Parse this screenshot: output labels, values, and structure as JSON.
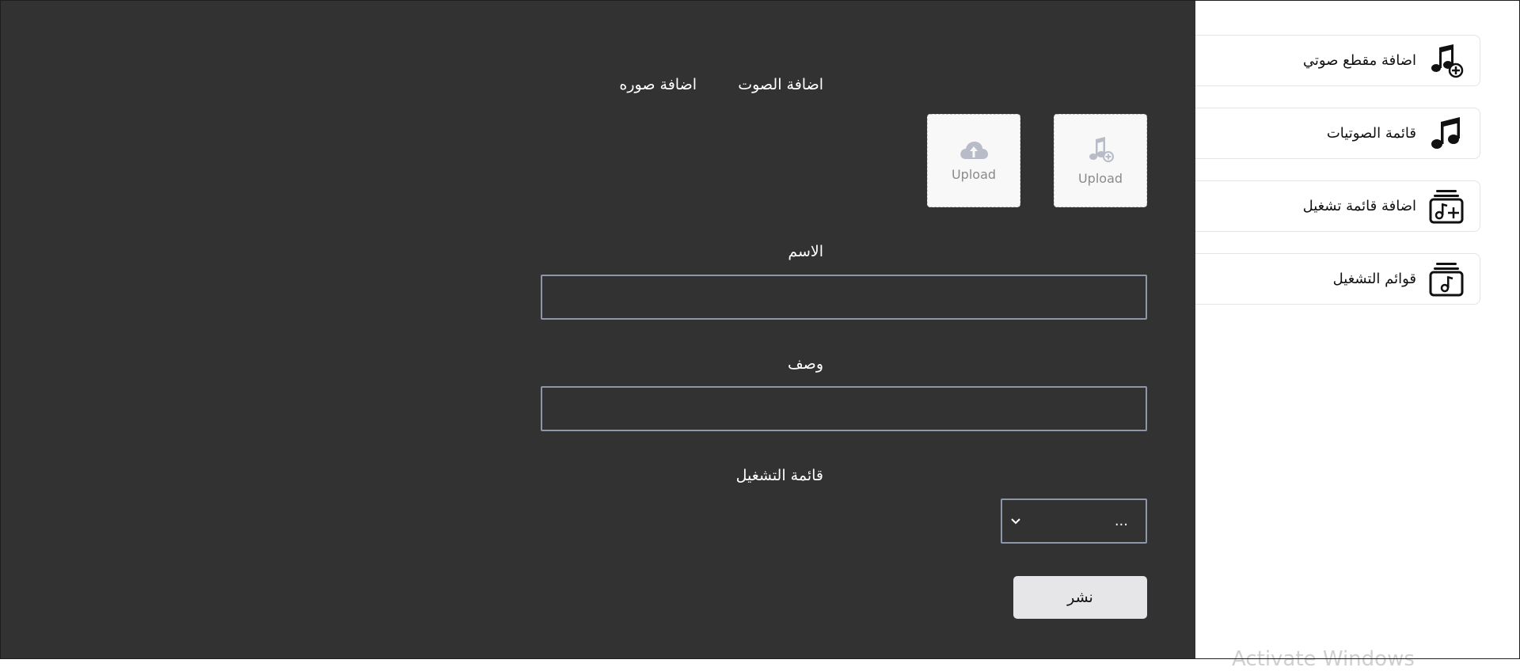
{
  "sidebar": {
    "items": [
      {
        "label": "اضافة مقطع صوتي",
        "icon": "music-note-add-icon"
      },
      {
        "label": "قائمة الصوتيات",
        "icon": "music-notes-icon"
      },
      {
        "label": "اضافة قائمة تشغيل",
        "icon": "playlist-add-icon"
      },
      {
        "label": "قوائم التشغيل",
        "icon": "playlist-icon"
      }
    ]
  },
  "form": {
    "audio_label": "اضافة الصوت",
    "image_label": "اضافة صوره",
    "audio_upload_text": "Upload",
    "image_upload_text": "Upload",
    "name_label": "الاسم",
    "name_value": "",
    "description_label": "وصف",
    "description_value": "",
    "playlist_label": "قائمة التشغيل",
    "playlist_selected": "...",
    "publish_label": "نشر"
  },
  "watermark": "Activate Windows",
  "colors": {
    "panel_bg": "#323232",
    "input_border": "#8d97a7",
    "button_bg": "#e6e6e9"
  }
}
